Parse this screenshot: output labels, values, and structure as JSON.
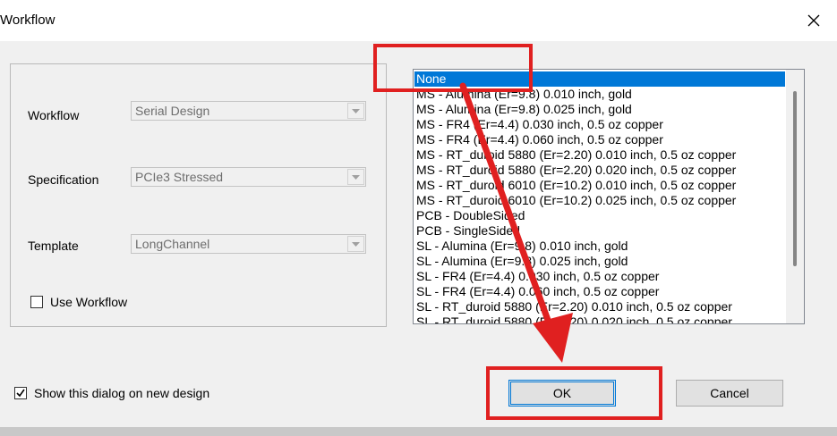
{
  "window": {
    "title": "Workflow",
    "close_icon": "close-icon"
  },
  "group": {
    "workflow_label": "Workflow",
    "workflow_value": "Serial Design",
    "specification_label": "Specification",
    "specification_value": "PCIe3 Stressed",
    "template_label": "Template",
    "template_value": "LongChannel",
    "use_workflow_label": "Use Workflow",
    "use_workflow_checked": false
  },
  "list": {
    "items": [
      "None",
      "MS - Alumina (Er=9.8) 0.010 inch, gold",
      "MS - Alumina (Er=9.8) 0.025 inch, gold",
      "MS - FR4 (Er=4.4) 0.030 inch, 0.5 oz copper",
      "MS - FR4 (Er=4.4) 0.060 inch, 0.5 oz copper",
      "MS - RT_duroid 5880 (Er=2.20) 0.010 inch, 0.5 oz copper",
      "MS - RT_duroid 5880 (Er=2.20) 0.020 inch, 0.5 oz copper",
      "MS - RT_duroid 6010 (Er=10.2) 0.010 inch, 0.5 oz copper",
      "MS - RT_duroid 6010 (Er=10.2) 0.025 inch, 0.5 oz copper",
      "PCB - DoubleSided",
      "PCB - SingleSided",
      "SL - Alumina (Er=9.8) 0.010 inch, gold",
      "SL - Alumina (Er=9.8) 0.025 inch, gold",
      "SL - FR4 (Er=4.4) 0.030 inch, 0.5 oz copper",
      "SL - FR4 (Er=4.4) 0.060 inch, 0.5 oz copper",
      "SL - RT_duroid 5880 (Er=2.20) 0.010 inch, 0.5 oz copper",
      "SL - RT_duroid 5880 (Er=2.20) 0.020 inch, 0.5 oz copper"
    ],
    "selected_index": 0
  },
  "footer": {
    "show_dialog_label": "Show this dialog on new design",
    "show_dialog_checked": true,
    "ok_label": "OK",
    "cancel_label": "Cancel"
  },
  "colors": {
    "selection": "#0078d7",
    "annotation": "#e02020"
  }
}
